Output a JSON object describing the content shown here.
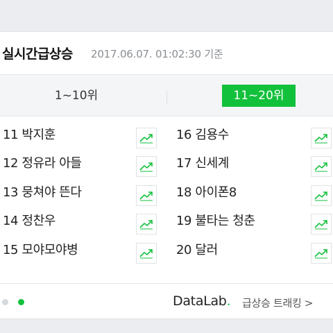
{
  "header": {
    "title": "실시간급상승",
    "timestamp": "2017.06.07. 01:02:30 기준"
  },
  "tabs": [
    {
      "label": "1~10위",
      "active": false
    },
    {
      "label": "11~20위",
      "active": true
    }
  ],
  "ranks_left": [
    {
      "text": "11 박지훈"
    },
    {
      "text": "12 정유라 아들"
    },
    {
      "text": "13 뭉쳐야 뜬다"
    },
    {
      "text": "14 정찬우"
    },
    {
      "text": "15 모야모야병"
    }
  ],
  "ranks_right": [
    {
      "text": "16 김용수"
    },
    {
      "text": "17 신세계"
    },
    {
      "text": "18 아이폰8"
    },
    {
      "text": "19 불타는 청춘"
    },
    {
      "text": "20 달러"
    }
  ],
  "trend_icon": "trend-chart-icon",
  "footer": {
    "brand": "DataLab",
    "brand_dot": ".",
    "tracking_label": "급상승 트래킹 >",
    "page_indicator": {
      "total": 2,
      "current": 2
    }
  },
  "colors": {
    "accent": "#12c13b",
    "background": "#ebedf0",
    "text": "#222222",
    "muted": "#8a8f94"
  }
}
